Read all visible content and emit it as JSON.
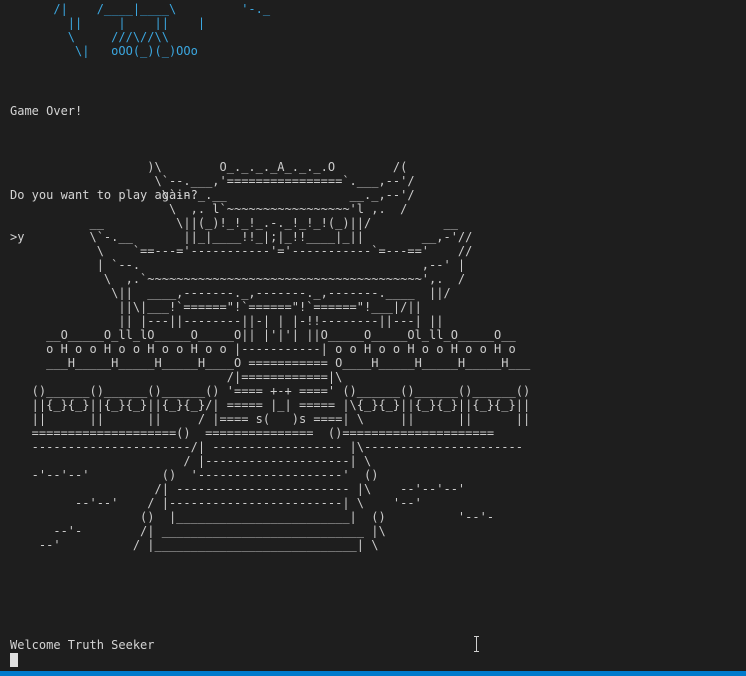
{
  "terminal": {
    "top_art": [
      "      /|    /____|____\\         '-._",
      "        ||     |    ||    |",
      "        \\     ///\\//\\\\",
      "         \\|   oOO(_)(_)OOo"
    ],
    "game_over": "Game Over!",
    "play_again_question": "Do you want to play again?",
    "user_input": ">y",
    "temple_art": [
      "                   )\\        O_._._._A_._._.O        /(",
      "                    \\`--.___,'================`.___,--'/",
      "                     \\`--._.__                 __._,--'/",
      "                      \\  ,. l`~~~~~~~~~~~~~~~~~'l ,.  /",
      "           __          \\||(_)!_!_!_.-._!_!_!(_)||/          __",
      "           \\`-.__       ||_|____!!_|;|_!!____|_||        __,-'//",
      "            \\    `==---='-----------'='-----------`=---=='    //",
      "            | `--.                                       ,--' |",
      "             \\  ,.`~~~~~~~~~~~~~~~~~~~~~~~~~~~~~~~~~~~~~~',.  /",
      "              \\||  ____,-------._,-------._,-------.____  ||/",
      "               ||\\|___!`======\"!`======\"!`======\"!___|/||",
      "               || |---||--------||-| | |-!!--------||---| ||",
      "     __O_____O_ll_lO_____O_____O|| |'|'| ||O_____O_____Ol_ll_O_____O__",
      "     o H o o H o o H o o H o o |-----------| o o H o o H o o H o o H o",
      "     ___H_____H_____H_____H____O =========== O____H_____H_____H_____H___",
      "                              /|============|\\",
      "   ()______()______()______() '==== +-+ ====' ()______()______()______()",
      "   ||{_}{_}||{_}{_}||{_}{_}/| ===== |_| ===== |\\{_}{_}||{_}{_}||{_}{_}||",
      "   ||      ||      ||     / |==== s(   )s ====| \\     ||      ||      ||",
      "   ====================()  ===============  ()=====================",
      "   ----------------------/| ------------------ |\\----------------------",
      "                        / |--------------------| \\",
      "   -'--'--'          ()  '--------------------'  ()",
      "                    /| ------------------------ |\\    --'--'--'",
      "         --'--'    / |------------------------| \\    '--'",
      "                  ()  |________________________|  ()          '--'-",
      "      --'-        /| ____________________________ |\\",
      "    --'          / |____________________________| \\"
    ],
    "welcome": "Welcome Truth Seeker"
  },
  "colors": {
    "background": "#1e1e1e",
    "text": "#cccccc",
    "top_art": "#3ba7e0",
    "status_bar": "#007acc"
  }
}
